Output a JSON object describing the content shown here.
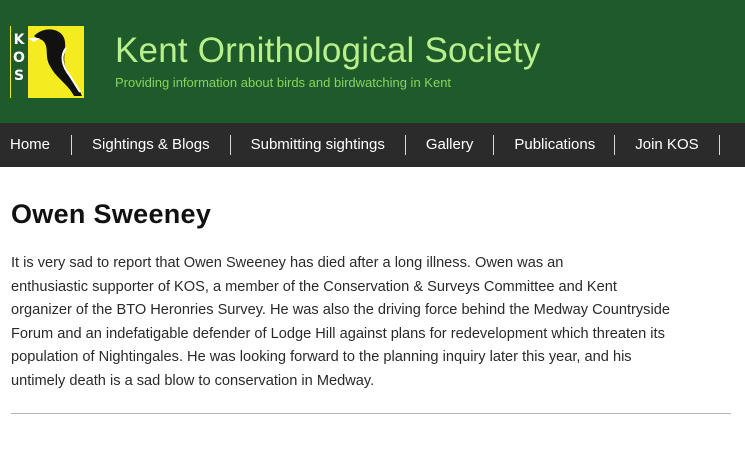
{
  "header": {
    "logo_letters": "KOS",
    "title": "Kent Ornithological Society",
    "tagline": "Providing information about birds and birdwatching in Kent",
    "colors": {
      "background": "#1f5a2a",
      "title": "#b8f08c",
      "tagline": "#86d45f",
      "logo_yellow": "#f5ec1f"
    }
  },
  "nav": {
    "items": [
      {
        "label": "Home"
      },
      {
        "label": "Sightings & Blogs"
      },
      {
        "label": "Submitting sightings"
      },
      {
        "label": "Gallery"
      },
      {
        "label": "Publications"
      },
      {
        "label": "Join KOS"
      }
    ],
    "colors": {
      "background": "#2b2b2b",
      "text": "#ffffff"
    }
  },
  "article": {
    "title": "Owen Sweeney",
    "lines": [
      "It is very sad to report that Owen Sweeney has died after a long illness. Owen was an",
      "enthusiastic supporter of KOS, a member of the Conservation & Surveys Committee and Kent",
      "organizer of the BTO Heronries Survey. He was also the driving force behind the Medway Countryside",
      "Forum and an indefatigable defender of Lodge Hill against plans for redevelopment which threaten its",
      "population of Nightingales. He was looking forward to the planning inquiry later this year, and his",
      "untimely death is a sad blow to conservation in Medway."
    ]
  }
}
